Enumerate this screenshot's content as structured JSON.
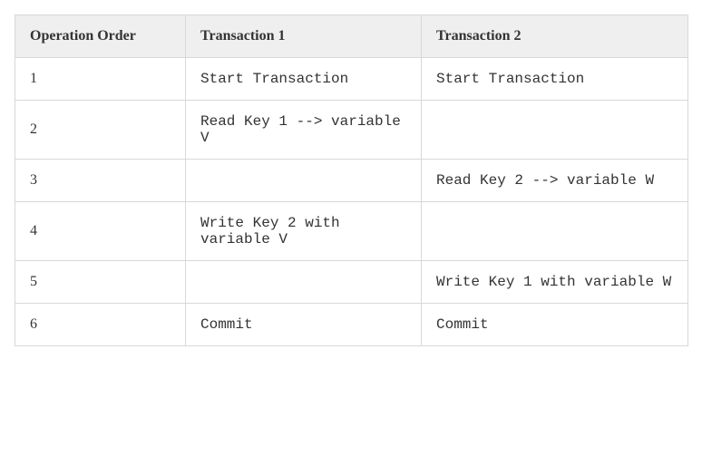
{
  "table": {
    "headers": [
      "Operation Order",
      "Transaction 1",
      "Transaction 2"
    ],
    "rows": [
      {
        "order": "1",
        "t1": "Start Transaction",
        "t2": "Start Transaction"
      },
      {
        "order": "2",
        "t1": "Read Key 1 --> variable V",
        "t2": ""
      },
      {
        "order": "3",
        "t1": "",
        "t2": "Read Key 2 --> variable W"
      },
      {
        "order": "4",
        "t1": "Write Key 2 with variable V",
        "t2": ""
      },
      {
        "order": "5",
        "t1": "",
        "t2": "Write Key 1 with variable W"
      },
      {
        "order": "6",
        "t1": "Commit",
        "t2": "Commit"
      }
    ]
  }
}
